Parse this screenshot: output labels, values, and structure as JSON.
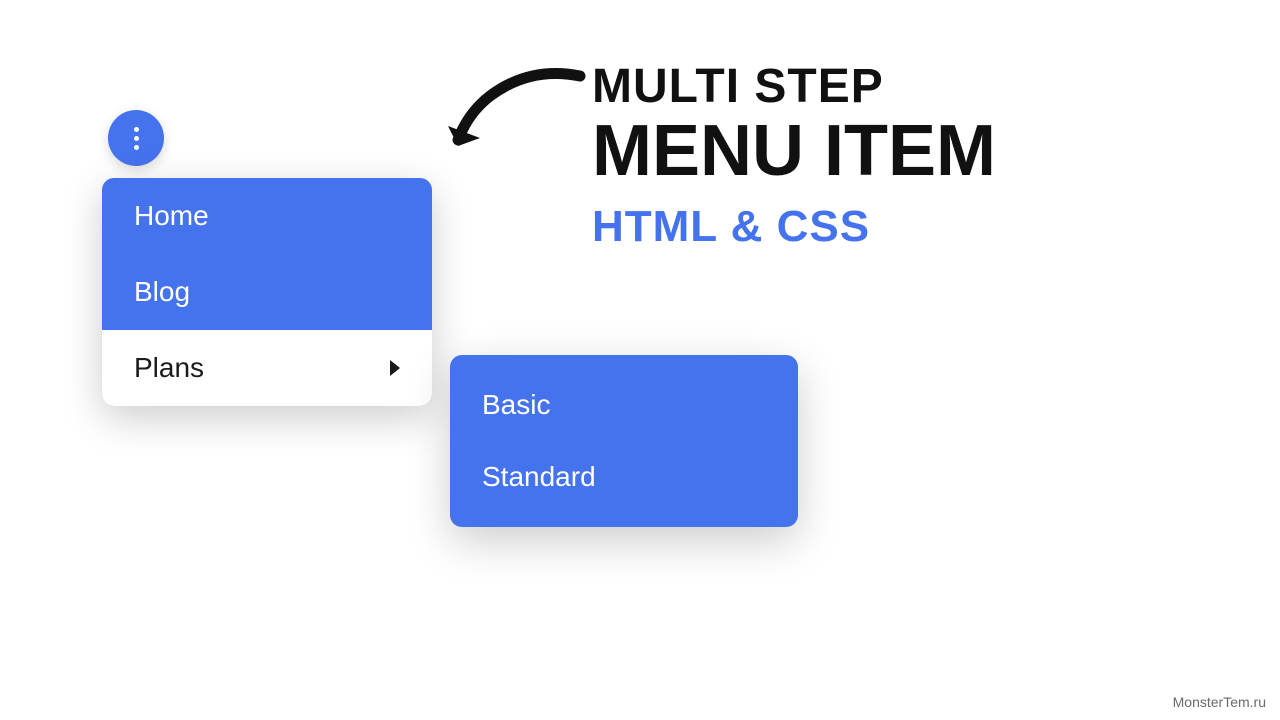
{
  "colors": {
    "accent": "#4572ed",
    "text_dark": "#111111",
    "white": "#ffffff"
  },
  "menu_trigger": {
    "icon": "vertical-dots"
  },
  "main_menu": {
    "items": [
      {
        "label": "Home",
        "active": false,
        "has_submenu": false
      },
      {
        "label": "Blog",
        "active": false,
        "has_submenu": false
      },
      {
        "label": "Plans",
        "active": true,
        "has_submenu": true
      }
    ]
  },
  "submenu": {
    "items": [
      {
        "label": "Basic"
      },
      {
        "label": "Standard"
      }
    ]
  },
  "heading": {
    "line1": "MULTI STEP",
    "line2": "MENU ITEM",
    "line3": "HTML & CSS"
  },
  "watermark": "MonsterTem.ru"
}
